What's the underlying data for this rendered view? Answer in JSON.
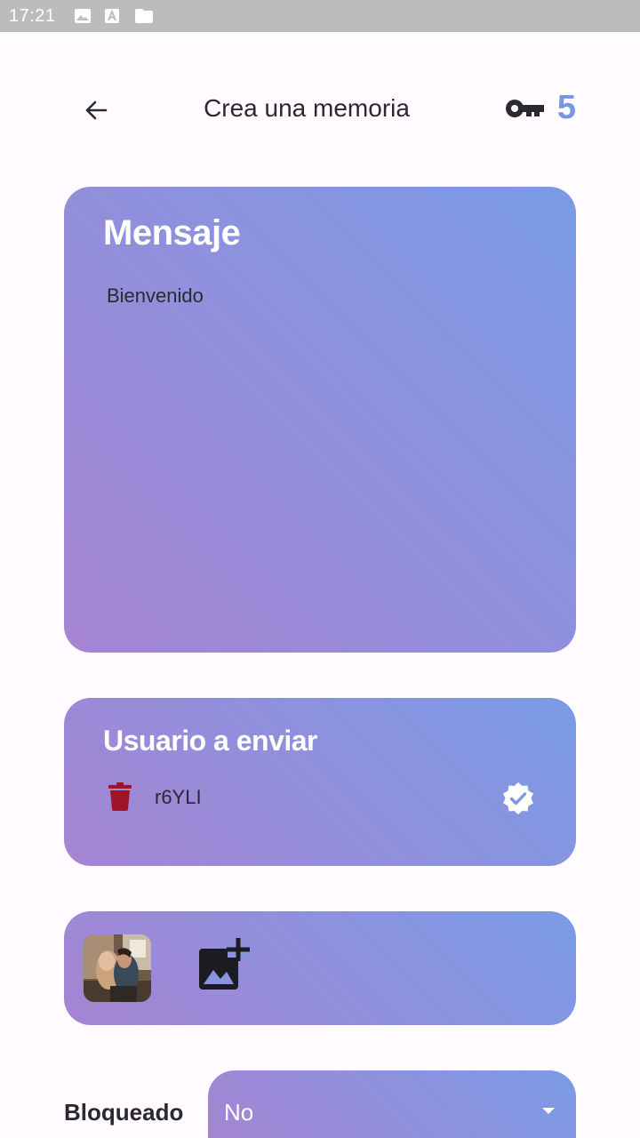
{
  "status_bar": {
    "time": "17:21",
    "icons": [
      "image-icon",
      "font-icon",
      "sd-card-icon"
    ]
  },
  "app_bar": {
    "title": "Crea una memoria",
    "back_icon": "arrow-back-icon",
    "key_icon": "key-icon",
    "key_count": "5",
    "accent_color": "#7897e2"
  },
  "message_card": {
    "title": "Mensaje",
    "text": "Bienvenido"
  },
  "user_card": {
    "title": "Usuario a enviar",
    "users": [
      {
        "name": "r6YLI",
        "delete_icon": "trash-icon",
        "status_icon": "verified-icon"
      }
    ]
  },
  "images_card": {
    "thumbnail_icon": "photo-thumbnail",
    "add_icon": "add-photo-icon"
  },
  "locked": {
    "label": "Bloqueado",
    "selected": "No"
  },
  "colors": {
    "gradient_start": "#a684d2",
    "gradient_end": "#7a9be6",
    "delete": "#a0142a"
  }
}
